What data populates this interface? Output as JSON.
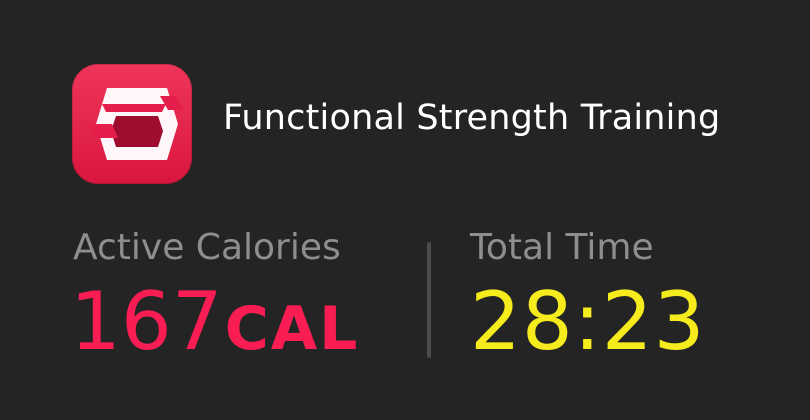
{
  "workout": {
    "icon": "functional-strength-icon",
    "title": "Functional Strength Training"
  },
  "metrics": {
    "calories": {
      "label": "Active Calories",
      "value": "167",
      "unit": "CAL"
    },
    "time": {
      "label": "Total Time",
      "value": "28:23"
    }
  },
  "colors": {
    "background": "#242424",
    "icon": "#e41f4b",
    "calories": "#fa1d53",
    "time": "#f6eb1c",
    "label": "#8e8e8e"
  }
}
